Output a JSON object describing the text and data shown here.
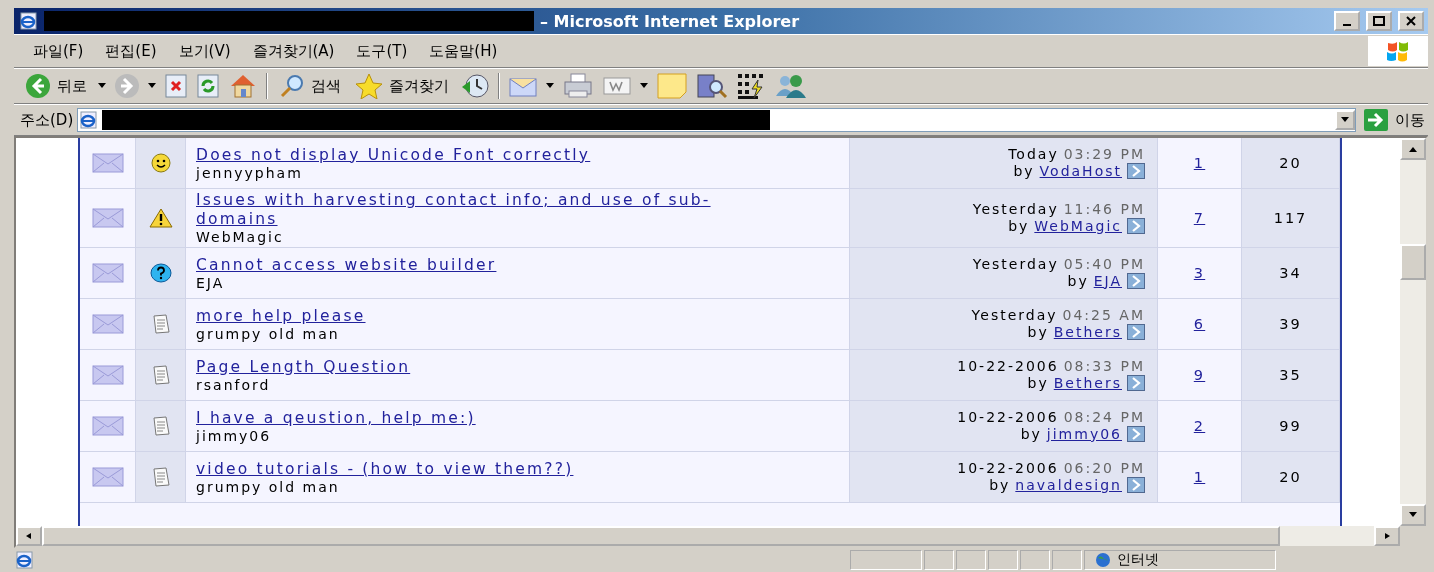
{
  "window": {
    "title": "– Microsoft Internet Explorer"
  },
  "menu": [
    "파일(F)",
    "편집(E)",
    "보기(V)",
    "즐겨찾기(A)",
    "도구(T)",
    "도움말(H)"
  ],
  "toolbar": {
    "back": "뒤로",
    "search": "검색",
    "favorites": "즐겨찾기"
  },
  "address": {
    "label": "주소(D)",
    "go": "이동"
  },
  "threads": [
    {
      "kind": "smile",
      "title": "Does not display Unicode Font correctly",
      "starter": "jennyypham",
      "day": "Today",
      "time": "03:29 PM",
      "by": "by",
      "last_poster": "VodaHost",
      "replies": "1",
      "views": "20"
    },
    {
      "kind": "warning",
      "title": "Issues with harvesting contact info; and use of sub-domains",
      "starter": "WebMagic",
      "day": "Yesterday",
      "time": "11:46 PM",
      "by": "by",
      "last_poster": "WebMagic",
      "replies": "7",
      "views": "117"
    },
    {
      "kind": "question",
      "title": "Cannot access website builder",
      "starter": "EJA",
      "day": "Yesterday",
      "time": "05:40 PM",
      "by": "by",
      "last_poster": "EJA",
      "replies": "3",
      "views": "34"
    },
    {
      "kind": "document",
      "title": "more help please",
      "starter": "grumpy old man",
      "day": "Yesterday",
      "time": "04:25 AM",
      "by": "by",
      "last_poster": "Bethers",
      "replies": "6",
      "views": "39"
    },
    {
      "kind": "document",
      "title": "Page Length Question",
      "starter": "rsanford",
      "day": "10-22-2006",
      "time": "08:33 PM",
      "by": "by",
      "last_poster": "Bethers",
      "replies": "9",
      "views": "35"
    },
    {
      "kind": "document",
      "title": "I have a qeustion, help me:)",
      "starter": "jimmy06",
      "day": "10-22-2006",
      "time": "08:24 PM",
      "by": "by",
      "last_poster": "jimmy06",
      "replies": "2",
      "views": "99"
    },
    {
      "kind": "document",
      "title": "video tutorials - (how to view them??)",
      "starter": "grumpy old man",
      "day": "10-22-2006",
      "time": "06:20 PM",
      "by": "by",
      "last_poster": "navaldesign",
      "replies": "1",
      "views": "20"
    }
  ],
  "status_bar": {
    "zone": "인터넷"
  }
}
